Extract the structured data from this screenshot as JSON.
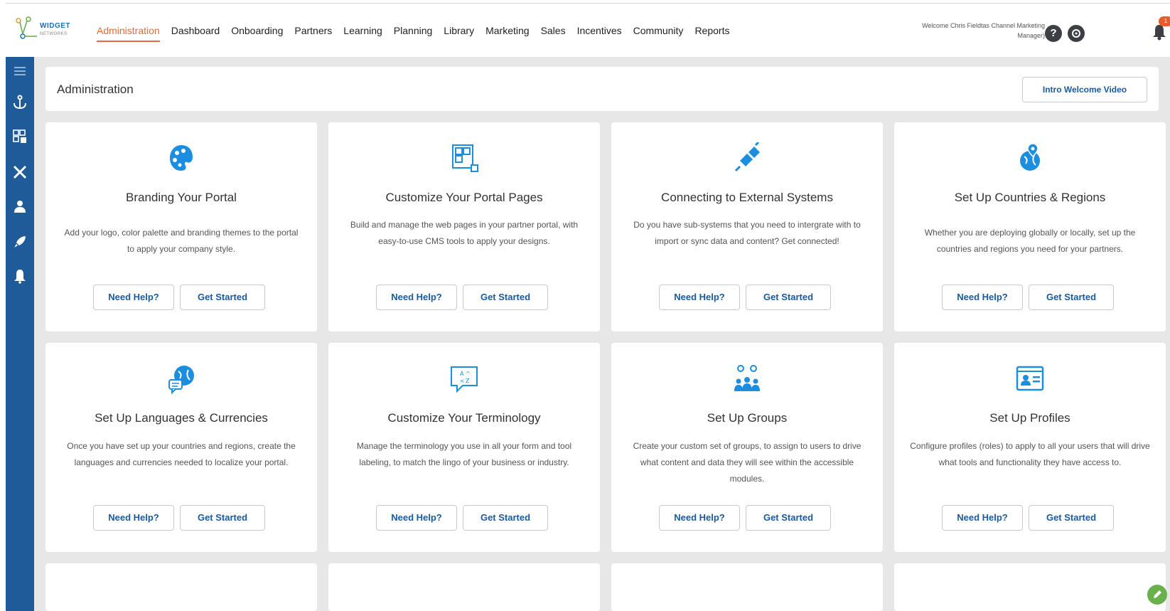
{
  "brand": {
    "name": "WIDGET",
    "sub": "NETWORKS"
  },
  "nav": [
    {
      "label": "Administration",
      "active": true
    },
    {
      "label": "Dashboard"
    },
    {
      "label": "Onboarding"
    },
    {
      "label": "Partners"
    },
    {
      "label": "Learning"
    },
    {
      "label": "Planning"
    },
    {
      "label": "Library"
    },
    {
      "label": "Marketing"
    },
    {
      "label": "Sales"
    },
    {
      "label": "Incentives"
    },
    {
      "label": "Community"
    },
    {
      "label": "Reports"
    }
  ],
  "user": {
    "welcome": "Welcome Chris Fieldtas Channel Marketing Manager)",
    "notifications": "1"
  },
  "sidebar": [
    "menu-icon",
    "anchor-icon",
    "pages-icon",
    "tools-icon",
    "user-icon",
    "rocket-icon",
    "bell-icon"
  ],
  "page": {
    "title": "Administration",
    "intro_button": "Intro Welcome Video"
  },
  "buttons": {
    "help": "Need Help?",
    "start": "Get Started"
  },
  "cards": [
    {
      "title": "Branding Your Portal",
      "desc": "Add your logo, color palette and branding themes to the portal to apply your company style.",
      "icon": "palette-icon"
    },
    {
      "title": "Customize Your Portal Pages",
      "desc": "Build and manage the web pages in your partner portal, with easy-to-use CMS tools to apply your designs.",
      "icon": "layout-icon"
    },
    {
      "title": "Connecting to External Systems",
      "desc": "Do you have sub-systems that you need to intergrate with to import or sync data and content? Get connected!",
      "icon": "plug-icon"
    },
    {
      "title": "Set Up Countries & Regions",
      "desc": "Whether you are deploying globally or locally, set up the countries and regions you need for your partners.",
      "icon": "globe-pin-icon"
    },
    {
      "title": "Set Up Languages & Currencies",
      "desc": "Once you have set up your countries and regions, create the languages and currencies needed to localize your portal.",
      "icon": "globe-chat-icon"
    },
    {
      "title": "Customize Your Terminology",
      "desc": "Manage the terminology you use in all your form and tool labeling, to match the lingo of your business or industry.",
      "icon": "terminology-icon"
    },
    {
      "title": "Set Up Groups",
      "desc": "Create your custom set of groups, to assign to users to drive what content and data they will see within the accessible modules.",
      "icon": "groups-icon"
    },
    {
      "title": "Set Up Profiles",
      "desc": "Configure profiles (roles) to apply to all your users that will drive what tools and functionality they have access to.",
      "icon": "profile-card-icon"
    }
  ],
  "colors": {
    "accent": "#e26a3c",
    "sidebar": "#1e5b98",
    "icon": "#1b8ee0",
    "link": "#1a5aa0"
  }
}
